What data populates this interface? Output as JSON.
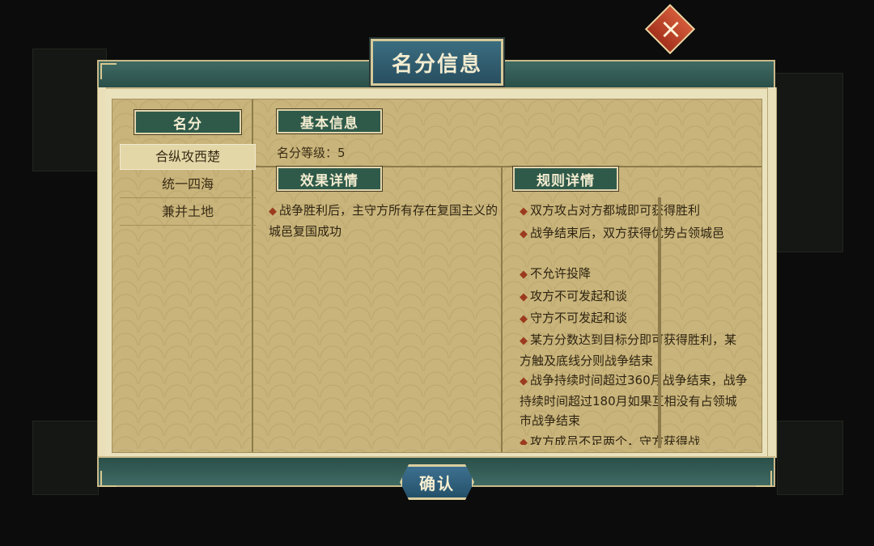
{
  "dialog": {
    "title": "名分信息",
    "confirm_label": "确认"
  },
  "left_panel": {
    "header": "名分",
    "items": [
      {
        "label": "合纵攻西楚",
        "selected": true
      },
      {
        "label": "统一四海",
        "selected": false
      },
      {
        "label": "兼并土地",
        "selected": false
      }
    ]
  },
  "basic_info": {
    "header": "基本信息",
    "level_text": "名分等级：5"
  },
  "effects": {
    "header": "效果详情",
    "items": [
      "战争胜利后，主守方所有存在复国主义的城邑复国成功"
    ]
  },
  "rules": {
    "header": "规则详情",
    "items": [
      "双方攻占对方都城即可获得胜利",
      "战争结束后，双方获得优势占领城邑",
      "不允许投降",
      "攻方不可发起和谈",
      "守方不可发起和谈",
      "某方分数达到目标分即可获得胜利，某方触及底线分则战争结束",
      "战争持续时间超过360月战争结束，战争持续时间超过180月如果互相没有占领城市战争结束",
      "攻方成员不足两个，守方获得战"
    ]
  },
  "colors": {
    "panel": "#c9b57b",
    "frame_teal": "#2f5a4a",
    "bullet": "#9b3a1f",
    "close": "#b8412a"
  }
}
